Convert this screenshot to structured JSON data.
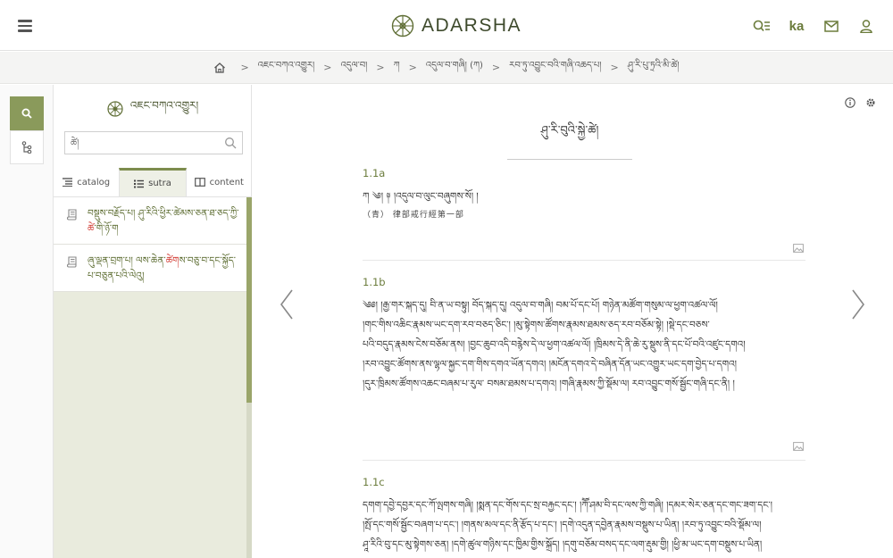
{
  "header": {
    "brand": "ADARSHA",
    "lang_label": "ka",
    "icons": [
      "menu-icon",
      "dharma-wheel-logo",
      "search-list-icon",
      "mail-icon",
      "user-icon"
    ]
  },
  "breadcrumb": {
    "items": [
      "འཇང་བཀའ་འགྱུར།",
      "འདུལ་བ།",
      "ཀ",
      "འདུལ་བ་གཞི། (ཀ)",
      "རབ་ཏུ་འབྱུང་བའི་གཞི་འཆད་པ།",
      "ཤུ་རི་པུ་ཏྲའི་མི་ཚེ།"
    ]
  },
  "sidebar": {
    "title": "འཇང་བཀའ་འགྱུར།",
    "search_value": "ཚེ།",
    "tabs": [
      {
        "label": "catalog",
        "active": false
      },
      {
        "label": "sutra",
        "active": true
      },
      {
        "label": "content",
        "active": false
      }
    ],
    "items": [
      {
        "before": "བསྡུས་བརྗོད་པ། ཤུ་རིའི་ཕྱིར་ཚེམས་ཅན་ཐ་ཅད་ཀྱི་",
        "highlight": "ཚེ",
        "after": "་གི་ཉོ་ག"
      },
      {
        "before": "ཞུ་ལྡན་བྲག་པ། ལས་ཆེན་",
        "highlight": "ཚེག",
        "after": "ས་བཅུ་བ་དང་སྐྱོད་པ་བཅུན་པའི་ལེའུ།"
      }
    ]
  },
  "reader": {
    "title": "ཤུ་རི་བུའི་སྐྱེ་ཚེ།",
    "folios": [
      {
        "label": "1.1a",
        "lines": [
          "ཀ ༄། ༈ །འདུལ་བ་ལུང་བཞུགས་སོ། །"
        ],
        "note": "（青） 律部戒行經第一部"
      },
      {
        "label": "1.1b",
        "lines": [
          "༄༅། །རྒྱ་གར་སྐད་དུ། བི་ན་ཡ་བསྟུ། བོད་སྐད་དུ། འདུལ་བ་གཞི། བམ་པོ་དང་པོ། གཉེན་མཚོག་གསུམ་ལ་ཕྱག་འཚལ་ལོ།",
          "།གང་གིས་འཆིང་རྣམས་ཡང་དག་རབ་བཅད་ཅིང་། །མུ་སྟེགས་ཚོགས་རྣམས་ཐམས་ཅད་རབ་བཅོམ་སྟེ། །སྡེ་དང་བཅས་",
          "པའི་བདུད་རྣམས་ངེས་བཅོམ་ནས། །བྱང་ཆུབ་འདི་བརྙེས་དེ་ལ་ཕྱག་འཚལ་ལོ། །ཁྲིམས་དེ་ནི་ཆེ་རུ་སྡུས་ནི་དང་པོ་བའི་འཛུང་དགའ།",
          "།རབ་འབྱུང་ཚོགས་ནས་ལྷལ་སྐྱང་དག་གིས་དགའ་ཡོན་དགའ། །མངོན་དགའ་དེ་བཞིན་དོན་ཡང་འགྱུར་ཡང་དག་བྱེད་པ་དགའ།",
          "།དུར་ཁྲིམས་ཚོགས་འཆང་བཞམ་པ་རུལ་ བསམ་ཐམས་པ་དགའ། །གཞི་རྣམས་ཀྱི་སྡོམ་ལ། རབ་འབྱུང་གསོ་སྦྱོང་གཞི་དང་ནི། །"
        ]
      },
      {
        "label": "1.1c",
        "lines": [
          "དགག་དབྱེ་དབྱར་དང་ཀོ་ལྤགས་གཞི། །སྨན་དང་གོས་དང་སྲ་བརྐྱང་དང་། །ཀཽ་ཤམ་བི་དང་ལས་ཀྱི་གཞི། །དམར་སེར་ཅན་དང་གང་ཟག་དང་།",
          "།སྤོ་དང་གསོ་སྦྱོང་བཞག་པ་དང་། །གནས་མལ་དང་ནི་རྩོད་པ་དང་། །དགེ་འདུན་དབྱེན་རྣམས་བསྡུས་པ་ཡིན། །རབ་ཏུ་འབྱུང་བའི་སྡོམ་ལ།",
          "ཤཱ་རིའི་བུ་དང་མུ་སྟེགས་ཅན། །དགེ་ཚུལ་གཉིས་དང་ཁྱིམ་གྱིས་སྐྲོད། །དགུ་བཅོམ་བསད་དང་ལག་རྡུམ་གྱི། །ཕྱི་མ་ཡང་དག་བསྡུས་པ་ཡིན།"
        ]
      }
    ]
  }
}
